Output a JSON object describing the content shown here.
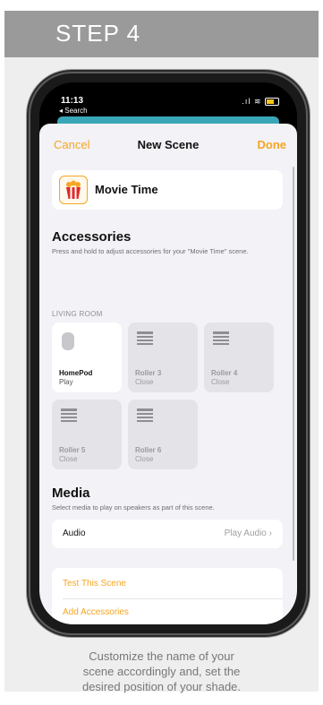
{
  "step": {
    "title": "STEP 4"
  },
  "status": {
    "time": "11:13",
    "back_label": "◂ Search"
  },
  "nav": {
    "cancel": "Cancel",
    "title": "New Scene",
    "done": "Done"
  },
  "scene": {
    "name": "Movie Time",
    "icon": "popcorn-icon"
  },
  "accessories": {
    "title": "Accessories",
    "subtitle": "Press and hold to adjust accessories for your \"Movie Time\" scene.",
    "room": "LIVING ROOM",
    "tiles": [
      {
        "name": "HomePod",
        "state": "Play",
        "icon": "homepod-icon",
        "active": true
      },
      {
        "name": "Roller 3",
        "state": "Close",
        "icon": "shade-icon",
        "active": false
      },
      {
        "name": "Roller 4",
        "state": "Close",
        "icon": "shade-icon",
        "active": false
      },
      {
        "name": "Roller 5",
        "state": "Close",
        "icon": "shade-icon",
        "active": false
      },
      {
        "name": "Roller 6",
        "state": "Close",
        "icon": "shade-icon",
        "active": false
      }
    ]
  },
  "media": {
    "title": "Media",
    "subtitle": "Select media to play on speakers as part of this scene.",
    "audio_label": "Audio",
    "audio_value": "Play Audio"
  },
  "actions": {
    "test": "Test This Scene",
    "add": "Add Accessories"
  },
  "caption": {
    "line1": "Customize the name of your",
    "line2": "scene accordingly and, set the",
    "line3": "desired position of your shade."
  },
  "colors": {
    "accent": "#f5a623",
    "header": "#9a9a9a",
    "sheet": "#f2f2f7"
  }
}
